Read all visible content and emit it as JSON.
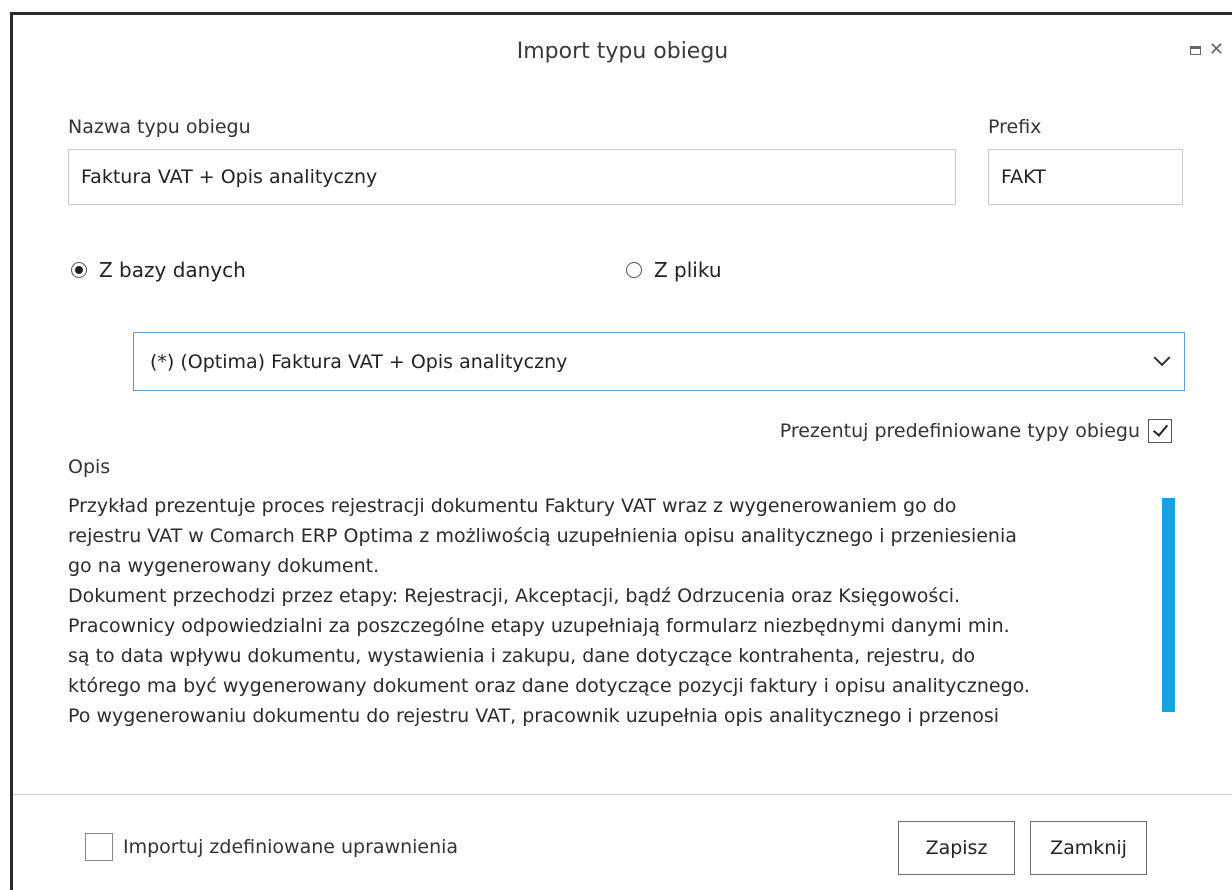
{
  "dialog": {
    "title": "Import typu obiegu"
  },
  "form": {
    "name_label": "Nazwa typu obiegu",
    "name_value": "Faktura VAT + Opis analityczny",
    "prefix_label": "Prefix",
    "prefix_value": "FAKT",
    "source_db_label": "Z bazy danych",
    "source_file_label": "Z pliku",
    "source_selected": "Z bazy danych",
    "select_value": "(*) (Optima) Faktura VAT + Opis analityczny",
    "predefined_label": "Prezentuj predefiniowane typy obiegu",
    "predefined_checked": true,
    "desc_label": "Opis",
    "desc_lines": [
      "Przykład prezentuje proces rejestracji dokumentu Faktury VAT wraz z wygenerowaniem go do",
      "rejestru VAT w Comarch ERP Optima z możliwością uzupełnienia opisu analitycznego i przeniesienia",
      "go na wygenerowany dokument.",
      "Dokument przechodzi przez etapy: Rejestracji, Akceptacji, bądź Odrzucenia oraz Księgowości.",
      "Pracownicy odpowiedzialni za poszczególne etapy uzupełniają formularz niezbędnymi danymi min.",
      "są to data wpływu dokumentu, wystawienia i zakupu, dane dotyczące kontrahenta, rejestru, do",
      "którego ma być wygenerowany dokument oraz dane dotyczące pozycji faktury i opisu analitycznego.",
      "Po wygenerowaniu dokumentu do  rejestru VAT, pracownik uzupełnia opis analitycznego i przenosi"
    ]
  },
  "footer": {
    "import_permissions_label": "Importuj zdefiniowane uprawnienia",
    "import_permissions_checked": false,
    "save_label": "Zapisz",
    "close_label": "Zamknij"
  },
  "colors": {
    "accent": "#5b9bd5",
    "scrollbar": "#1a9fe0"
  }
}
